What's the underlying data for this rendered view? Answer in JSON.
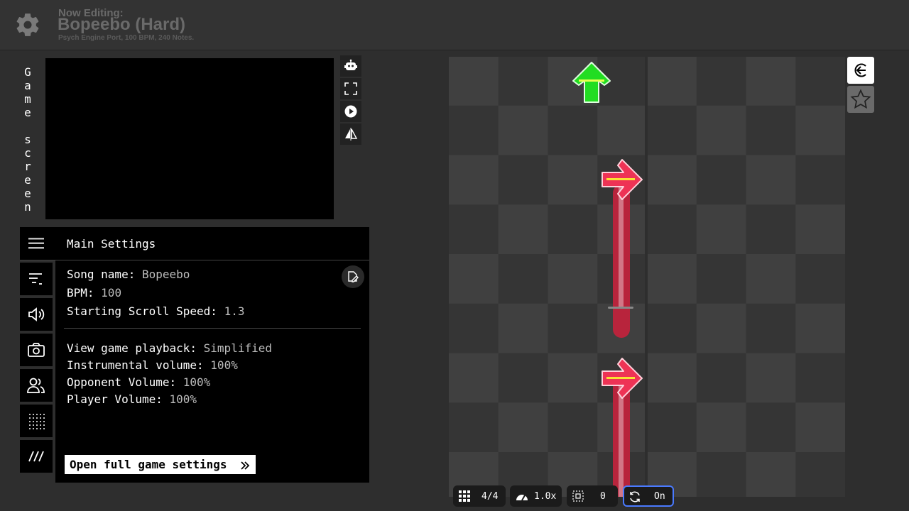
{
  "header": {
    "now_editing": "Now Editing:",
    "song_title": "Bopeebo (Hard)",
    "song_meta": "Psych Engine Port, 100 BPM, 240 Notes."
  },
  "game_screen": {
    "vertical_label": [
      "G",
      "a",
      "m",
      "e",
      " ",
      "s",
      "c",
      "r",
      "e",
      "e",
      "n"
    ]
  },
  "panel": {
    "title": "Main Settings",
    "song_name_label": "Song name: ",
    "song_name_value": "Bopeebo",
    "bpm_label": "BPM: ",
    "bpm_value": "100",
    "scroll_speed_label": "Starting Scroll Speed: ",
    "scroll_speed_value": "1.3",
    "playback_label": "View game playback: ",
    "playback_value": "Simplified",
    "inst_label": "Instrumental volume: ",
    "inst_value": "100%",
    "opp_label": "Opponent Volume: ",
    "opp_value": "100%",
    "player_label": "Player Volume: ",
    "player_value": "100%",
    "full_settings_label": "Open full game settings"
  },
  "bottom_bar": {
    "time_signature": "4/4",
    "playback_speed": "1.0x",
    "snap_value": "0",
    "metronome_state": "On"
  },
  "colors": {
    "up_arrow": "#22dd22",
    "right_arrow": "#ee3355",
    "sustain": "#b8243c",
    "grid_light": "#404040",
    "grid_dark": "#353535",
    "active_border": "#4a7aff"
  }
}
